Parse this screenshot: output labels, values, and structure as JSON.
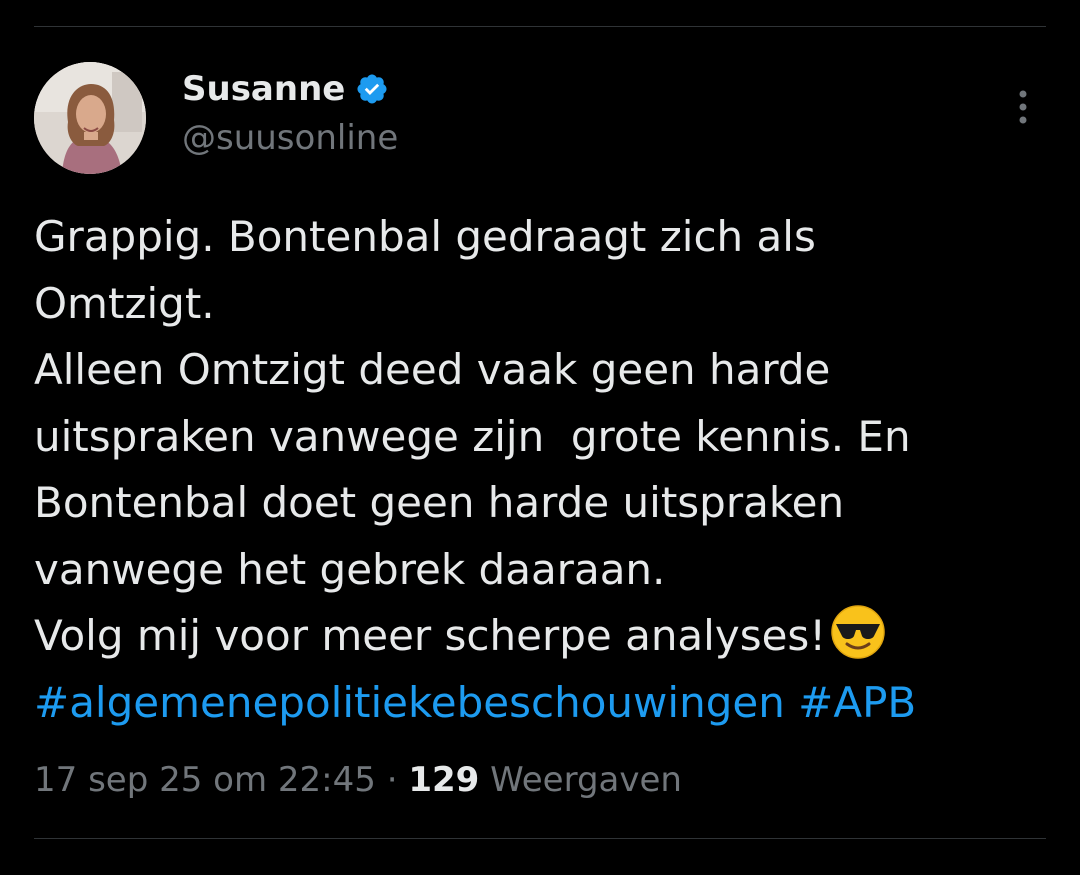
{
  "author": {
    "display_name": "Susanne",
    "handle": "@suusonline",
    "verified": true,
    "avatar_icon": "profile-photo"
  },
  "tweet": {
    "lines": [
      "Grappig. Bontenbal gedraagt zich als",
      "Omtzigt.",
      "Alleen Omtzigt deed vaak geen harde",
      "uitspraken vanwege zijn  grote kennis. En",
      "Bontenbal doet geen harde uitspraken",
      "vanwege het gebrek daaraan.",
      "Volg mij voor meer scherpe analyses!"
    ],
    "emoji": "smiling-face-with-sunglasses",
    "hashtags": [
      "#algemenepolitiekebeschouwingen",
      "#APB"
    ]
  },
  "meta": {
    "timestamp": "17 sep 25 om 22:45",
    "separator": " · ",
    "views_count": "129",
    "views_label": "Weergaven"
  },
  "colors": {
    "background": "#000000",
    "text": "#e7e9ea",
    "muted": "#71767b",
    "accent": "#1d9bf0"
  },
  "icons": [
    "verified-badge-icon",
    "more-options-icon",
    "sunglasses-emoji-icon"
  ]
}
